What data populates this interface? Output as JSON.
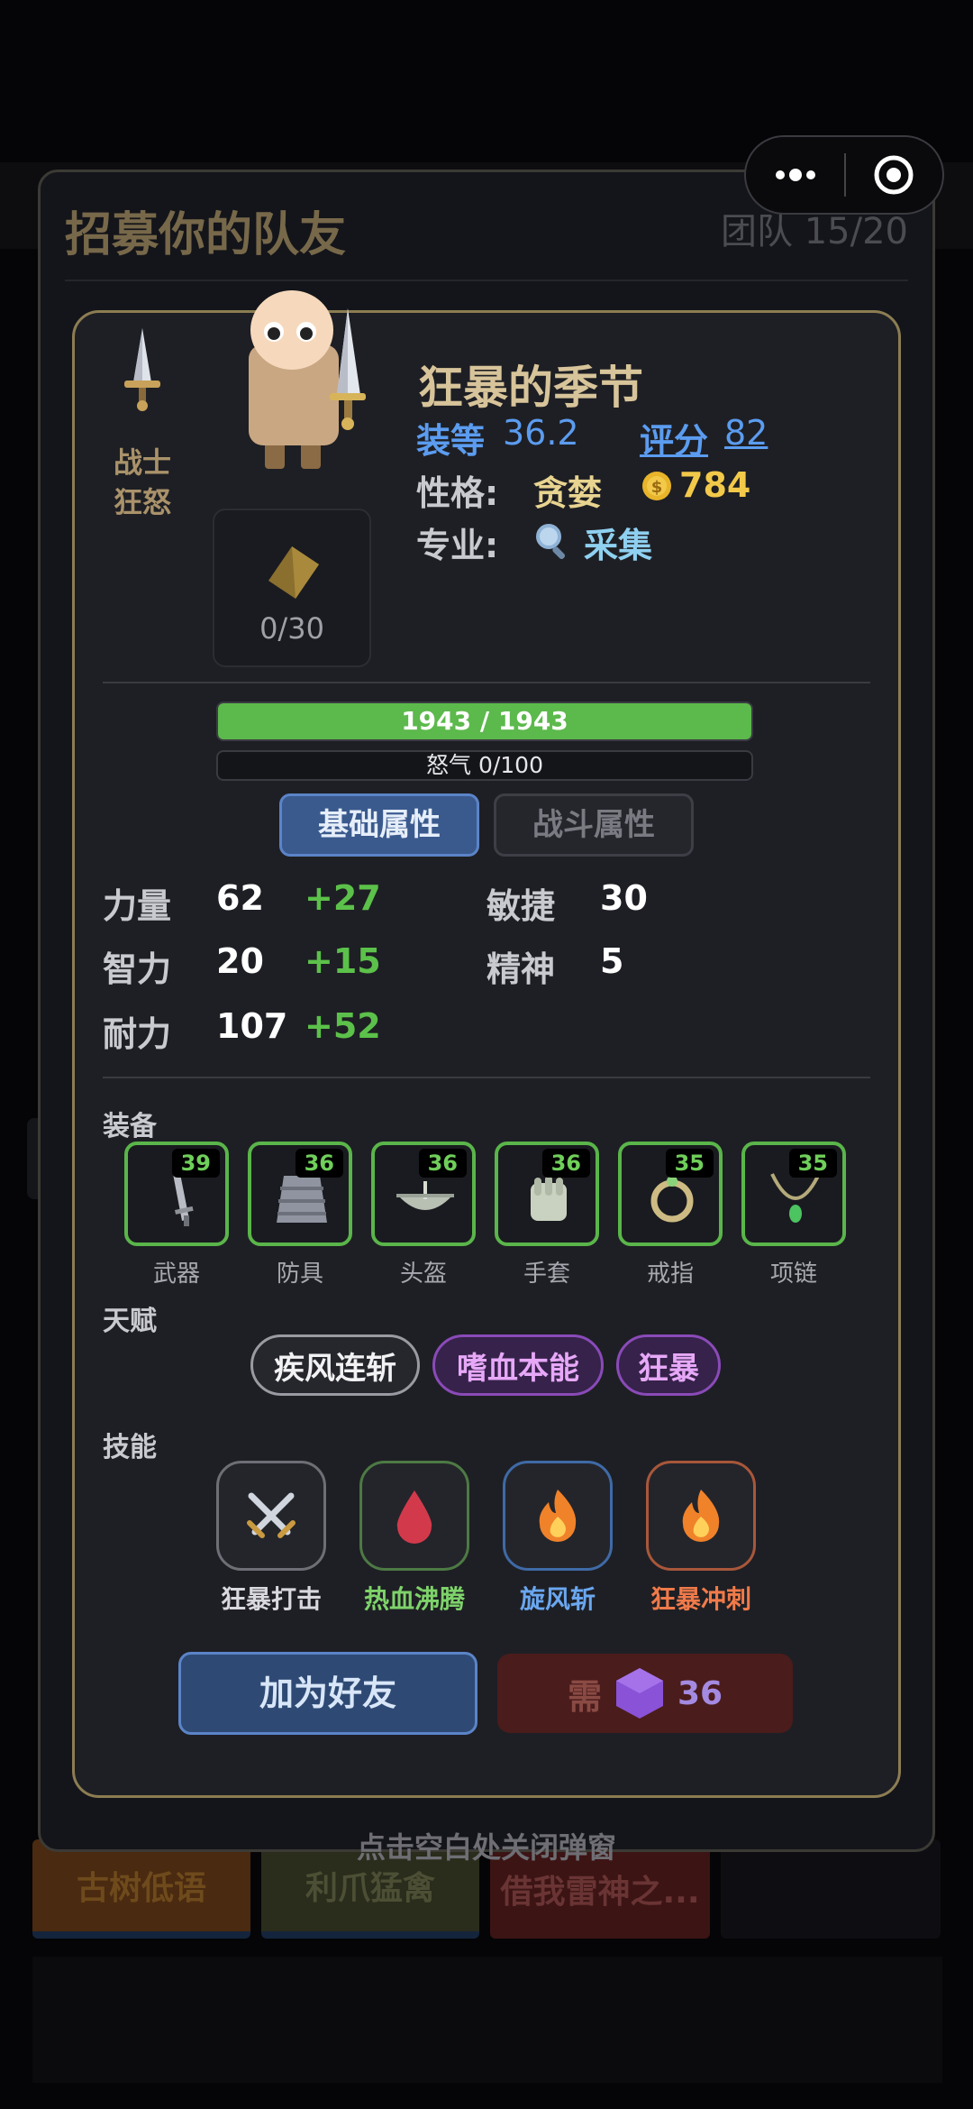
{
  "background": {
    "bottom_tiles": [
      "古树低语",
      "利爪猛禽",
      "借我雷神之..."
    ]
  },
  "dialog": {
    "title": "招募你的队友",
    "team_count": "团队 15/20",
    "close_hint": "点击空白处关闭弹窗"
  },
  "hero": {
    "class_name": "战士",
    "spec": "狂怒",
    "name": "狂暴的季节",
    "item_level_label": "装等",
    "item_level": "36.2",
    "score_label": "评分",
    "score": "82",
    "personality_label": "性格:",
    "personality": "贪婪",
    "gold": "784",
    "profession_label": "专业:",
    "profession": "采集",
    "fragments": "0/30",
    "hp_text": "1943 / 1943",
    "hp_fraction": 1.0,
    "rage_text": "怒气 0/100",
    "rage_fraction": 0.0
  },
  "tabs": {
    "basic": "基础属性",
    "combat": "战斗属性",
    "active": "basic"
  },
  "stats": {
    "strength": {
      "name": "力量",
      "value": "62",
      "bonus": "+27"
    },
    "intellect": {
      "name": "智力",
      "value": "20",
      "bonus": "+15"
    },
    "stamina": {
      "name": "耐力",
      "value": "107",
      "bonus": "+52"
    },
    "agility": {
      "name": "敏捷",
      "value": "30"
    },
    "spirit": {
      "name": "精神",
      "value": "5"
    }
  },
  "equipment": {
    "label": "装备",
    "slots": [
      {
        "name": "武器",
        "level": "39",
        "icon": "sword-icon"
      },
      {
        "name": "防具",
        "level": "36",
        "icon": "armor-icon"
      },
      {
        "name": "头盔",
        "level": "36",
        "icon": "helmet-icon"
      },
      {
        "name": "手套",
        "level": "36",
        "icon": "glove-icon"
      },
      {
        "name": "戒指",
        "level": "35",
        "icon": "ring-icon"
      },
      {
        "name": "项链",
        "level": "35",
        "icon": "necklace-icon"
      }
    ]
  },
  "talents": {
    "label": "天赋",
    "items": [
      "疾风连斩",
      "嗜血本能",
      "狂暴"
    ]
  },
  "skills": {
    "label": "技能",
    "items": [
      {
        "name": "狂暴打击",
        "icon": "crossed-swords-icon",
        "color": "#d8d8de"
      },
      {
        "name": "热血沸腾",
        "icon": "blood-drop-icon",
        "color": "#7ed36a"
      },
      {
        "name": "旋风斩",
        "icon": "fire-icon",
        "color": "#6aa7f0"
      },
      {
        "name": "狂暴冲刺",
        "icon": "fire-icon",
        "color": "#f07a4a"
      }
    ]
  },
  "actions": {
    "add_friend": "加为好友",
    "need_label": "需",
    "cost": "36"
  },
  "colors": {
    "accent_gold": "#8c7d52",
    "hp_green": "#5cb94c",
    "link_blue": "#5b9cf0",
    "bonus_green": "#5cc14a"
  }
}
